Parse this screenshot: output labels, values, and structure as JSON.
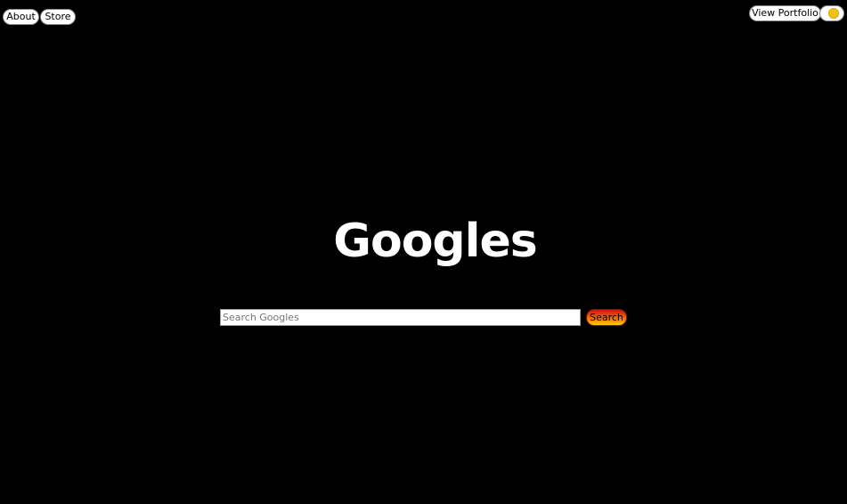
{
  "top_nav": {
    "about_label": "About",
    "store_label": "Store"
  },
  "top_right": {
    "portfolio_label": "View Portfolio",
    "theme_toggle_icon": "sun-icon"
  },
  "logo": {
    "text": "Googles"
  },
  "search": {
    "placeholder": "Search Googles",
    "value": "",
    "button_label": "Search"
  },
  "colors": {
    "background": "#000000",
    "logo_text": "#ffffff",
    "sun": "#f2c01d",
    "search_button_gradient": [
      "#d4130f",
      "#ef5a0c",
      "#ffcc00"
    ]
  }
}
